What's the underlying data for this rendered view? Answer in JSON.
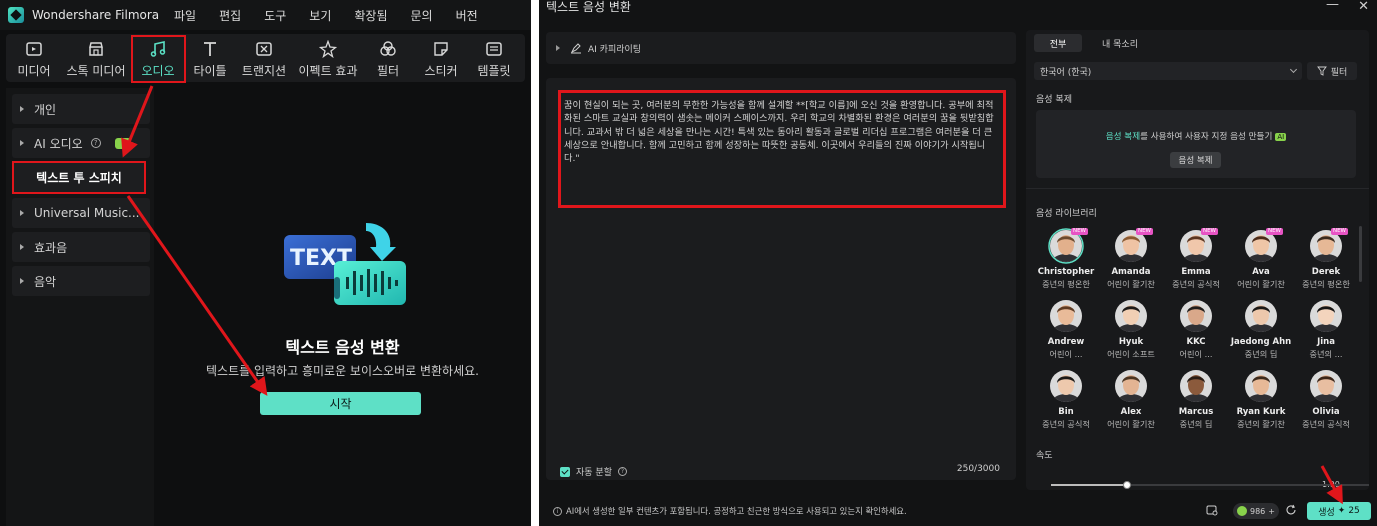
{
  "left": {
    "app_name": "Wondershare Filmora",
    "menu": [
      "파일",
      "편집",
      "도구",
      "보기",
      "확장됨",
      "문의",
      "버전"
    ],
    "toolbar": [
      {
        "label": "미디어",
        "icon": "media-icon"
      },
      {
        "label": "스톡 미디어",
        "icon": "stock-media-icon"
      },
      {
        "label": "오디오",
        "icon": "music-note-icon"
      },
      {
        "label": "타이틀",
        "icon": "title-t-icon"
      },
      {
        "label": "트랜지션",
        "icon": "transition-icon"
      },
      {
        "label": "이펙트 효과",
        "icon": "effects-star-icon"
      },
      {
        "label": "필터",
        "icon": "filter-icon"
      },
      {
        "label": "스티커",
        "icon": "sticker-icon"
      },
      {
        "label": "템플릿",
        "icon": "template-icon"
      }
    ],
    "sidebar": {
      "personal": "개인",
      "ai_audio": "AI 오디오",
      "tts": "텍스트 투 스피치",
      "universal": "Universal Music...",
      "sfx": "효과음",
      "music": "음악"
    },
    "illustration_text": "TEXT",
    "empty_title": "텍스트 음성 변환",
    "empty_desc": "텍스트를 입력하고 흥미로운 보이스오버로 변환하세요.",
    "start_label": "시작"
  },
  "right": {
    "window_title": "텍스트 음성 변환",
    "minimize": "—",
    "close": "✕",
    "copywriting": "AI 카피라이팅",
    "editor_text": "꿈이 현실이 되는 곳, 여러분의 무한한 가능성을 함께 설계할 **[학교 이름]에 오신 것을 환영합니다. 공부에 최적화된 스마트 교실과 창의력이 샘솟는 메이커 스페이스까지. 우리 학교의 차별화된 환경은 여러분의 꿈을 뒷받침합니다. 교과서 밖 더 넓은 세상을 만나는 시간! 특색 있는 동아리 활동과 글로벌 리더십 프로그램은 여러분을 더 큰 세상으로 안내합니다. 함께 고민하고 함께 성장하는 따뜻한 공동체. 이곳에서 우리들의 진짜 이야기가 시작됩니다.\"",
    "auto_split": "자동 분할",
    "char_count": "250/3000",
    "tabs": [
      "전부",
      "내 목소리"
    ],
    "language": "한국어 (한국)",
    "filter": "필터",
    "clone_heading": "음성 복제",
    "clone_link": "음성 복제",
    "clone_text": "를 사용하여 사용자 지정 음성 만들기",
    "ai_badge": "AI",
    "clone_btn": "음성 복제",
    "library_heading": "음성 라이브러리",
    "new_badge": "NEW",
    "voices": [
      {
        "name": "Christopher",
        "desc": "중년의 평온한",
        "new": true,
        "skin": "#e2b08c",
        "hair": "#6b4a2f"
      },
      {
        "name": "Amanda",
        "desc": "어린이 활기찬",
        "new": true,
        "skin": "#efc3a4",
        "hair": "#8a5a32"
      },
      {
        "name": "Emma",
        "desc": "중년의 공식적",
        "new": true,
        "skin": "#f0c7ab",
        "hair": "#5a3520"
      },
      {
        "name": "Ava",
        "desc": "어린이 활기찬",
        "new": true,
        "skin": "#efc6a7",
        "hair": "#4a2a18"
      },
      {
        "name": "Derek",
        "desc": "중년의 평온한",
        "new": true,
        "skin": "#e6b896",
        "hair": "#3a2a1e"
      },
      {
        "name": "Andrew",
        "desc": "어린이 ...",
        "new": false,
        "skin": "#e9bb99",
        "hair": "#5d3a22"
      },
      {
        "name": "Hyuk",
        "desc": "어린이 소프트",
        "new": false,
        "skin": "#f1cfb4",
        "hair": "#1d1a18"
      },
      {
        "name": "KKC",
        "desc": "어린이 ...",
        "new": false,
        "skin": "#d9a88a",
        "hair": "#1f1c1a"
      },
      {
        "name": "Jaedong Ahn",
        "desc": "중년의 딥",
        "new": false,
        "skin": "#edc8ac",
        "hair": "#1a1816"
      },
      {
        "name": "Jina",
        "desc": "중년의 ...",
        "new": false,
        "skin": "#f3d4bd",
        "hair": "#151312"
      },
      {
        "name": "Bin",
        "desc": "중년의 공식적",
        "new": false,
        "skin": "#eec9ad",
        "hair": "#1b1917"
      },
      {
        "name": "Alex",
        "desc": "어린이 활기찬",
        "new": false,
        "skin": "#e3b493",
        "hair": "#4b3522"
      },
      {
        "name": "Marcus",
        "desc": "중년의 딥",
        "new": false,
        "skin": "#8b5a3c",
        "hair": "#2a1c14"
      },
      {
        "name": "Ryan Kurk",
        "desc": "중년의 활기찬",
        "new": false,
        "skin": "#e7b997",
        "hair": "#3c2a1c"
      },
      {
        "name": "Olivia",
        "desc": "중년의 공식적",
        "new": false,
        "skin": "#e8bea1",
        "hair": "#3b2518"
      }
    ],
    "speed_heading": "속도",
    "speed_value": "1.00",
    "speed_fraction": 0.24,
    "footer_info": "AI에서 생성한 일부 컨텐츠가 포함됩니다. 공정하고 친근한 방식으로 사용되고 있는지 확인하세요.",
    "credits": "986",
    "generate_label": "생성",
    "generate_cost": "25"
  },
  "colors": {
    "accent": "#5ee0c6",
    "highlight": "#e0161b",
    "new_badge": "#e754c4",
    "ai_badge": "#88d24b"
  }
}
